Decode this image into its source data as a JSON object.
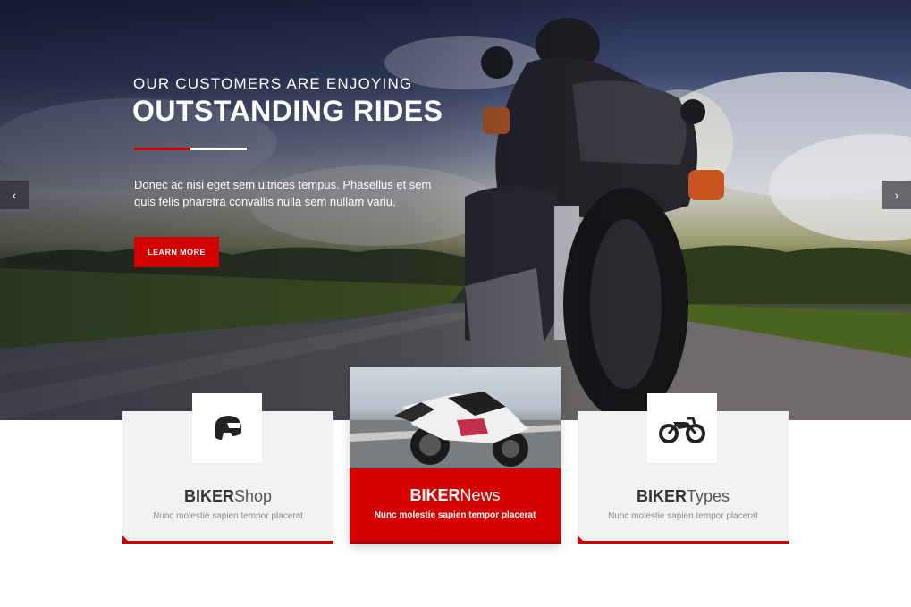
{
  "hero": {
    "subtitle": "OUR CUSTOMERS ARE ENJOYING",
    "title": "OUTSTANDING RIDES",
    "text": "Donec ac nisi eget sem ultrices tempus. Phasellus et sem quis felis pharetra convallis nulla sem nullam variu.",
    "button_label": "LEARN MORE",
    "prev_arrow": "‹",
    "next_arrow": "›"
  },
  "cards": [
    {
      "title_bold": "BIKER",
      "title_light": "Shop",
      "desc": "Nunc molestie sapien tempor placerat",
      "icon": "helmet-icon"
    },
    {
      "title_bold": "BIKER",
      "title_light": "News",
      "desc": "Nunc molestie sapien tempor placerat",
      "icon": "motorcycle-photo"
    },
    {
      "title_bold": "BIKER",
      "title_light": "Types",
      "desc": "Nunc molestie sapien tempor placerat",
      "icon": "motorcycle-icon"
    }
  ],
  "colors": {
    "accent": "#d40000",
    "card_bg": "#f2f2f2",
    "text_dark": "#333333",
    "text_muted": "#8a8a8a"
  }
}
